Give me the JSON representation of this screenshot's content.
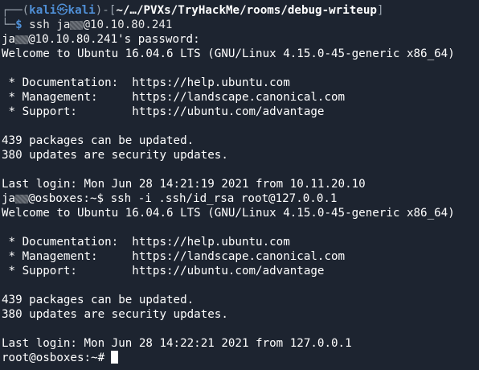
{
  "prompt1": {
    "frame_top": "┌──(",
    "user": "kali",
    "at_symbol": "㉿",
    "host": "kali",
    "mid": ")-[",
    "path": "~/…/PVXs/TryHackMe/rooms/debug-writeup",
    "end": "]",
    "frame_bottom": "└─",
    "dollar": "$",
    "command_prefix": " ssh ja",
    "command_suffix": "@10.10.80.241"
  },
  "lines": {
    "password_prefix": "ja",
    "password_suffix": "@10.10.80.241's password:",
    "welcome": "Welcome to Ubuntu 16.04.6 LTS (GNU/Linux 4.15.0-45-generic x86_64)",
    "doc": " * Documentation:  https://help.ubuntu.com",
    "mgmt": " * Management:     https://landscape.canonical.com",
    "support": " * Support:        https://ubuntu.com/advantage",
    "pkgs": "439 packages can be updated.",
    "security": "380 updates are security updates.",
    "last_login_1": "Last login: Mon Jun 28 14:21:19 2021 from 10.11.20.10",
    "prompt2_prefix": "ja",
    "prompt2_suffix": "@osboxes:~$ ssh -i .ssh/id_rsa root@127.0.0.1",
    "last_login_2": "Last login: Mon Jun 28 14:22:21 2021 from 127.0.0.1",
    "root_prompt": "root@osboxes:~#"
  }
}
